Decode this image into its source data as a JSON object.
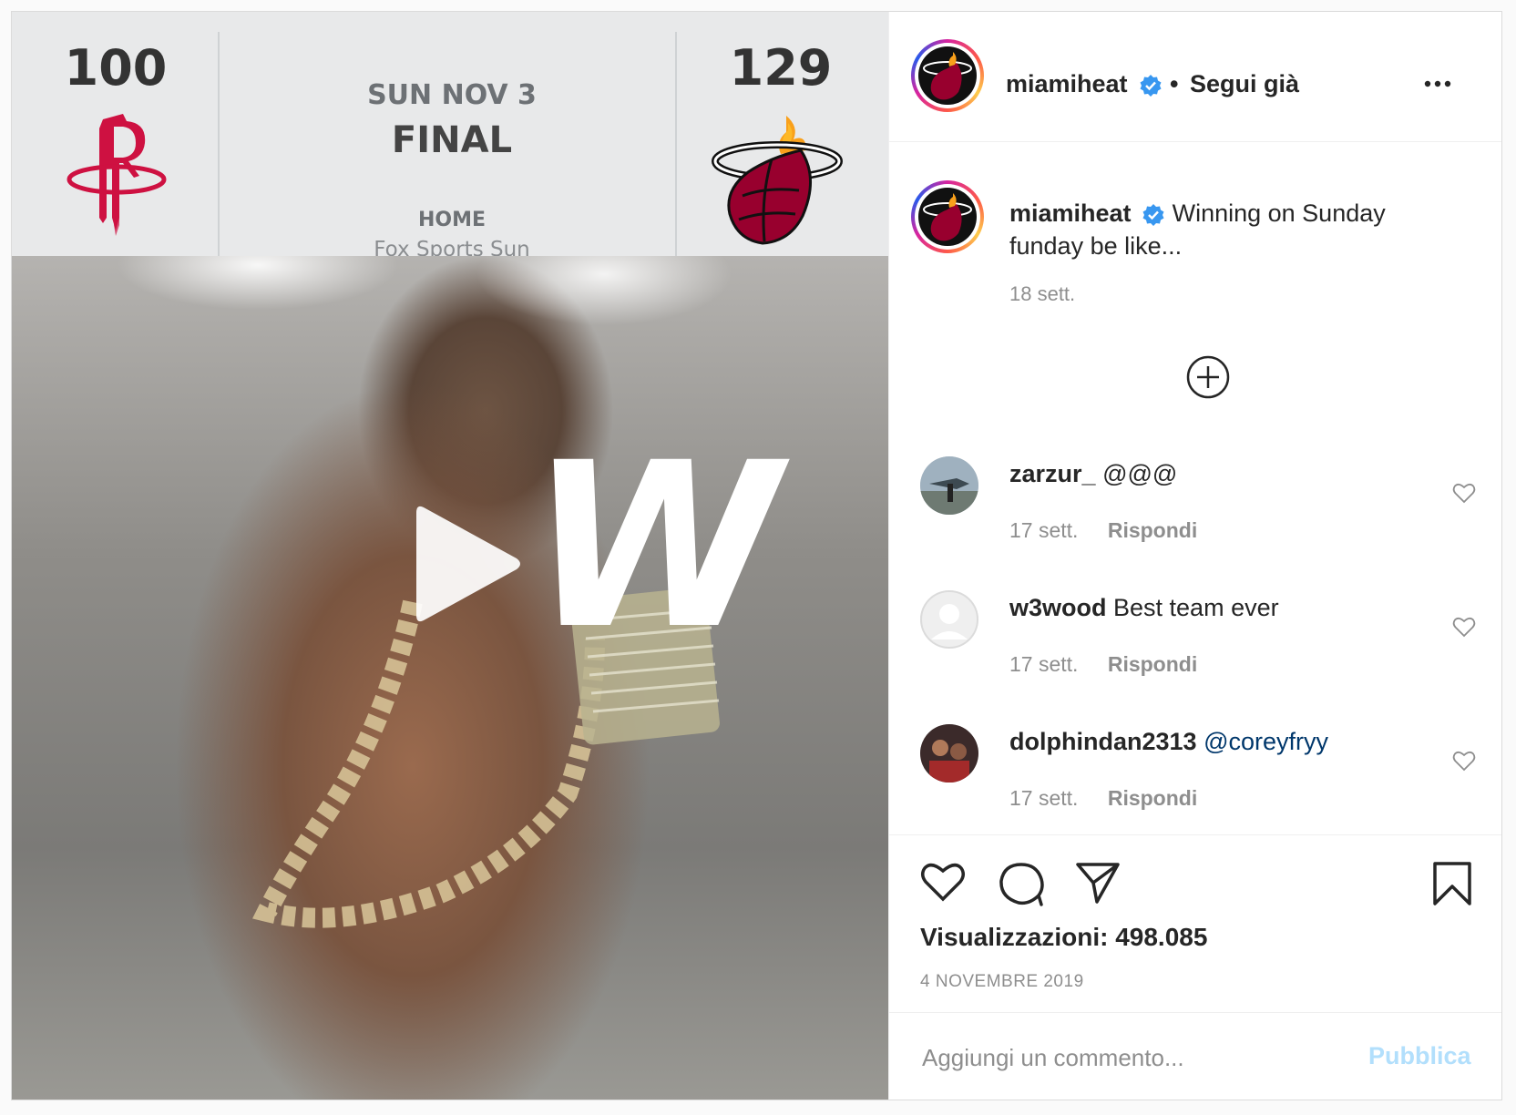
{
  "scoreboard": {
    "away_score": "100",
    "home_score": "129",
    "date": "SUN NOV 3",
    "status": "FINAL",
    "venue_label": "HOME",
    "network": "Fox Sports Sun"
  },
  "media": {
    "overlay_letter": "W"
  },
  "header": {
    "username": "miamiheat",
    "separator": "•",
    "follow_label": "Segui già"
  },
  "caption": {
    "username": "miamiheat",
    "text": "Winning on Sunday funday be like...",
    "time": "18 sett."
  },
  "comments": [
    {
      "username": "zarzur_",
      "text": "@@@",
      "time": "17 sett.",
      "reply_label": "Rispondi"
    },
    {
      "username": "w3wood",
      "text": "Best team ever",
      "time": "17 sett.",
      "reply_label": "Rispondi"
    },
    {
      "username": "dolphindan2313",
      "text": "@coreyfryy",
      "time": "17 sett.",
      "reply_label": "Rispondi"
    }
  ],
  "stats": {
    "views": "Visualizzazioni: 498.085",
    "date": "4 NOVEMBRE 2019"
  },
  "add_comment": {
    "placeholder": "Aggiungi un commento...",
    "publish_label": "Pubblica"
  },
  "colors": {
    "verified": "#3897f0",
    "heat_red": "#98002e",
    "rockets_red": "#ce1141",
    "mention": "#00376b",
    "publish_disabled": "#b2dffc"
  },
  "icons": [
    "play-icon",
    "verified-badge-icon",
    "more-options-icon",
    "add-circle-icon",
    "heart-icon",
    "comment-icon",
    "share-icon",
    "bookmark-icon"
  ]
}
